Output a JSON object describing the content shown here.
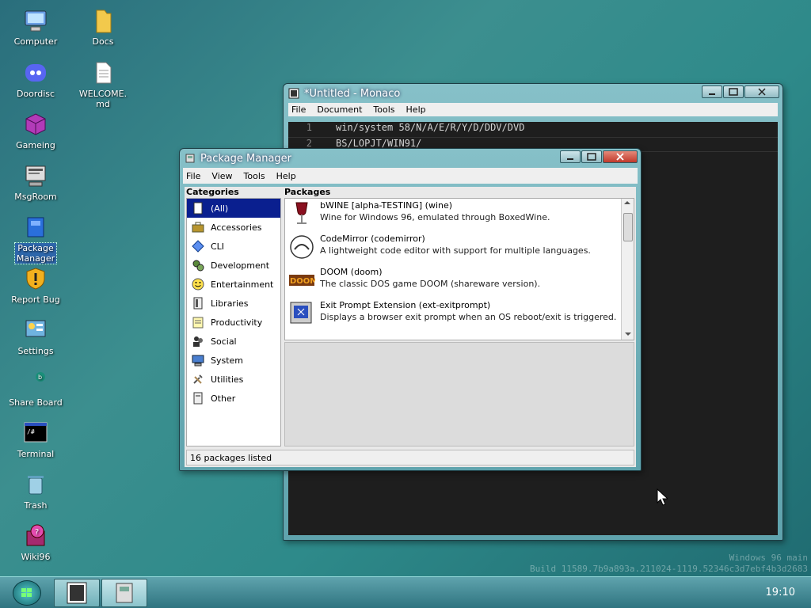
{
  "desktop": {
    "icons": [
      {
        "label": "Computer"
      },
      {
        "label": "Docs"
      },
      {
        "label": "Doordisc"
      },
      {
        "label": "WELCOME.\nmd"
      },
      {
        "label": "Gameing"
      },
      {
        "label": "MsgRoom"
      },
      {
        "label": "Package\nManager"
      },
      {
        "label": "Report Bug"
      },
      {
        "label": "Settings"
      },
      {
        "label": "Share Board"
      },
      {
        "label": "Terminal"
      },
      {
        "label": "Trash"
      },
      {
        "label": "Wiki96"
      }
    ],
    "build_info": {
      "line1": "Windows 96 main",
      "line2": "Build 11589.7b9a893a.211024-1119.52346c3d7ebf4b3d2683"
    }
  },
  "monaco": {
    "title": "*Untitled - Monaco",
    "menu": [
      "File",
      "Document",
      "Tools",
      "Help"
    ],
    "lines": [
      {
        "n": "1",
        "text": "win/system 58/N/A/E/R/Y/D/DDV/DVD"
      },
      {
        "n": "2",
        "text": "BS/LOPJT/WIN91/"
      }
    ]
  },
  "package_manager": {
    "title": "Package Manager",
    "menu": [
      "File",
      "View",
      "Tools",
      "Help"
    ],
    "categories_header": "Categories",
    "packages_header": "Packages",
    "categories": [
      "(All)",
      "Accessories",
      "CLI",
      "Development",
      "Entertainment",
      "Libraries",
      "Productivity",
      "Social",
      "System",
      "Utilities",
      "Other"
    ],
    "packages": [
      {
        "name": "bWINE [alpha-TESTING] (wine)",
        "desc": "Wine for Windows 96, emulated through BoxedWine."
      },
      {
        "name": "CodeMirror (codemirror)",
        "desc": "A lightweight code editor with support for multiple languages."
      },
      {
        "name": "DOOM (doom)",
        "desc": "The classic DOS game DOOM (shareware version)."
      },
      {
        "name": "Exit Prompt Extension (ext-exitprompt)",
        "desc": "Displays a browser exit prompt when an OS reboot/exit is triggered."
      }
    ],
    "status": "16 packages listed"
  },
  "taskbar": {
    "clock": "19:10"
  }
}
